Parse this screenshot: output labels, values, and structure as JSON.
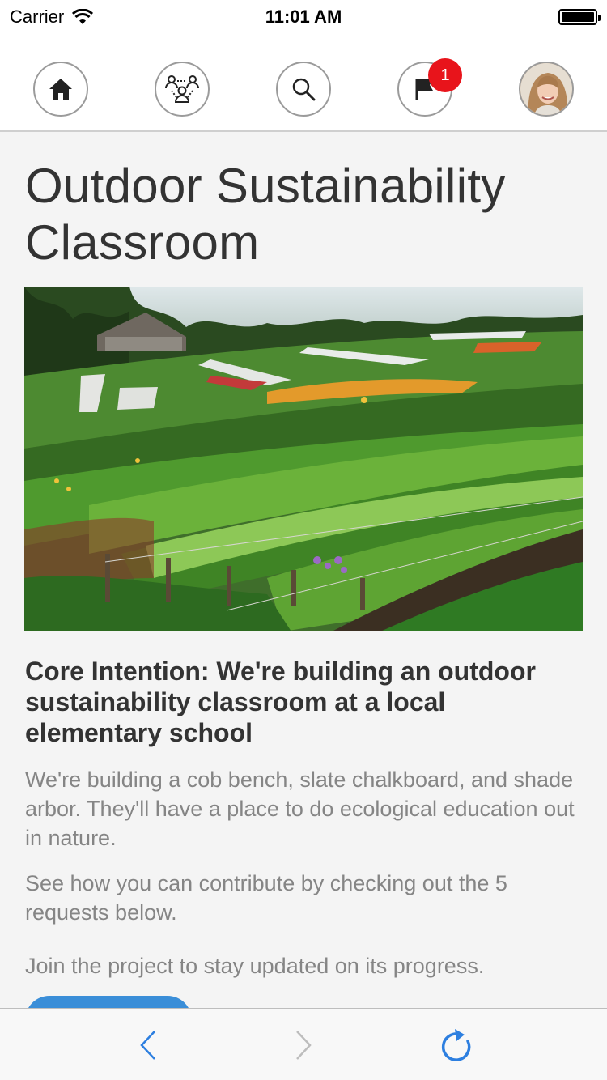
{
  "status_bar": {
    "carrier": "Carrier",
    "time": "11:01 AM",
    "battery_level": 1.0
  },
  "nav": {
    "home_icon": "home-icon",
    "community_icon": "group-icon",
    "search_icon": "search-icon",
    "flag_icon": "flag-icon",
    "notification_count": "1",
    "profile_icon": "avatar"
  },
  "page": {
    "title": "Outdoor Sustainability Classroom",
    "hero_image": "garden-photo",
    "core_intention": "Core Intention: We're building an outdoor sustainability classroom at a local elementary school",
    "description": "We're building a cob bench, slate chalkboard, and shade arbor. They'll have a place to do ecological education out in nature.",
    "contribute_text": "See how you can contribute by checking out the 5 requests below.",
    "join_text": "Join the project to stay updated on its progress."
  },
  "toolbar": {
    "back_icon": "chevron-left-icon",
    "forward_icon": "chevron-right-icon",
    "reload_icon": "reload-icon"
  },
  "colors": {
    "accent": "#3a8ed8",
    "badge": "#e8141b",
    "text_dark": "#333333",
    "text_muted": "#858585"
  }
}
